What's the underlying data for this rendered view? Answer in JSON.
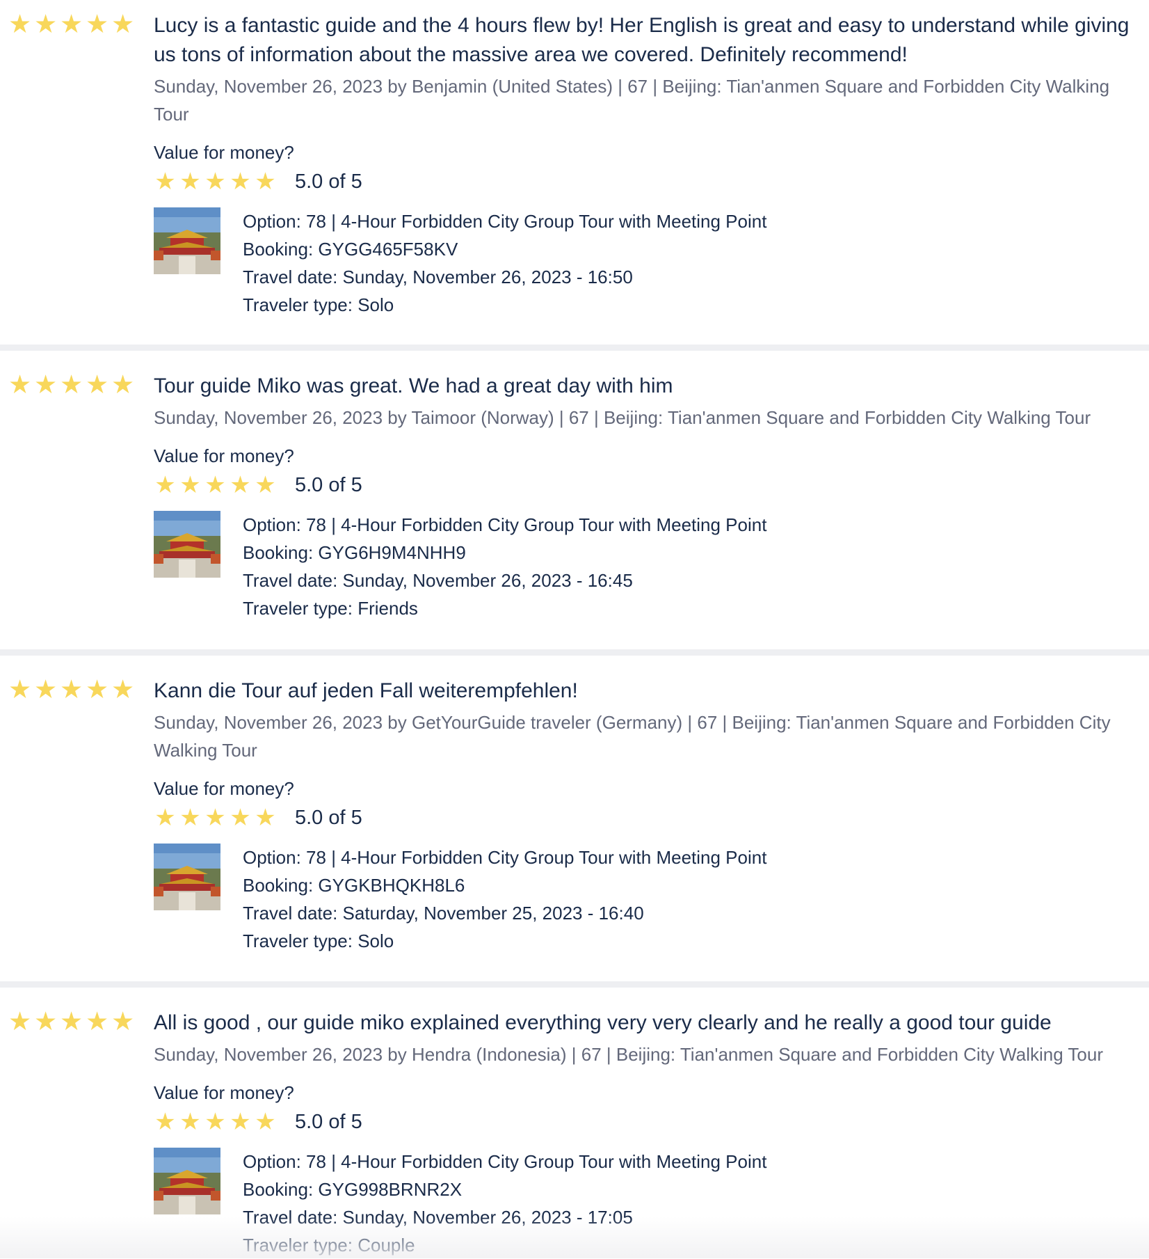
{
  "colors": {
    "star": "#f8d75b",
    "text_primary": "#1a2b49",
    "text_meta": "#63687a",
    "separator": "#eeeff2"
  },
  "reviews": [
    {
      "title": "Lucy is a fantastic guide and the 4 hours flew by! Her English is great and easy to understand while giving us tons of information about the massive area we covered. Definitely recommend!",
      "meta": "Sunday, November 26, 2023 by Benjamin (United States) | 67 | Beijing: Tian'anmen Square and Forbidden City Walking Tour",
      "rating": 5,
      "vfm_label": "Value for money?",
      "vfm_rating": 5,
      "vfm_score": "5.0 of 5",
      "option": "Option: 78 | 4-Hour Forbidden City Group Tour with Meeting Point",
      "booking": "Booking: GYGG465F58KV",
      "travel_date": "Travel date: Sunday, November 26, 2023 - 16:50",
      "traveler_type": "Traveler type: Solo"
    },
    {
      "title": "Tour guide Miko was great. We had a great day with him",
      "meta": "Sunday, November 26, 2023 by Taimoor (Norway) | 67 | Beijing: Tian'anmen Square and Forbidden City Walking Tour",
      "rating": 5,
      "vfm_label": "Value for money?",
      "vfm_rating": 5,
      "vfm_score": "5.0 of 5",
      "option": "Option: 78 | 4-Hour Forbidden City Group Tour with Meeting Point",
      "booking": "Booking: GYG6H9M4NHH9",
      "travel_date": "Travel date: Sunday, November 26, 2023 - 16:45",
      "traveler_type": "Traveler type: Friends"
    },
    {
      "title": "Kann die Tour auf jeden Fall weiterempfehlen!",
      "meta": "Sunday, November 26, 2023 by GetYourGuide traveler (Germany) | 67 | Beijing: Tian'anmen Square and Forbidden City Walking Tour",
      "rating": 5,
      "vfm_label": "Value for money?",
      "vfm_rating": 5,
      "vfm_score": "5.0 of 5",
      "option": "Option: 78 | 4-Hour Forbidden City Group Tour with Meeting Point",
      "booking": "Booking: GYGKBHQKH8L6",
      "travel_date": "Travel date: Saturday, November 25, 2023 - 16:40",
      "traveler_type": "Traveler type: Solo"
    },
    {
      "title": "All is good , our guide miko explained everything very very clearly and he really a good tour guide",
      "meta": "Sunday, November 26, 2023 by Hendra (Indonesia) | 67 | Beijing: Tian'anmen Square and Forbidden City Walking Tour",
      "rating": 5,
      "vfm_label": "Value for money?",
      "vfm_rating": 5,
      "vfm_score": "5.0 of 5",
      "option": "Option: 78 | 4-Hour Forbidden City Group Tour with Meeting Point",
      "booking": "Booking: GYG998BRNR2X",
      "travel_date": "Travel date: Sunday, November 26, 2023 - 17:05",
      "traveler_type": "Traveler type: Couple"
    }
  ]
}
